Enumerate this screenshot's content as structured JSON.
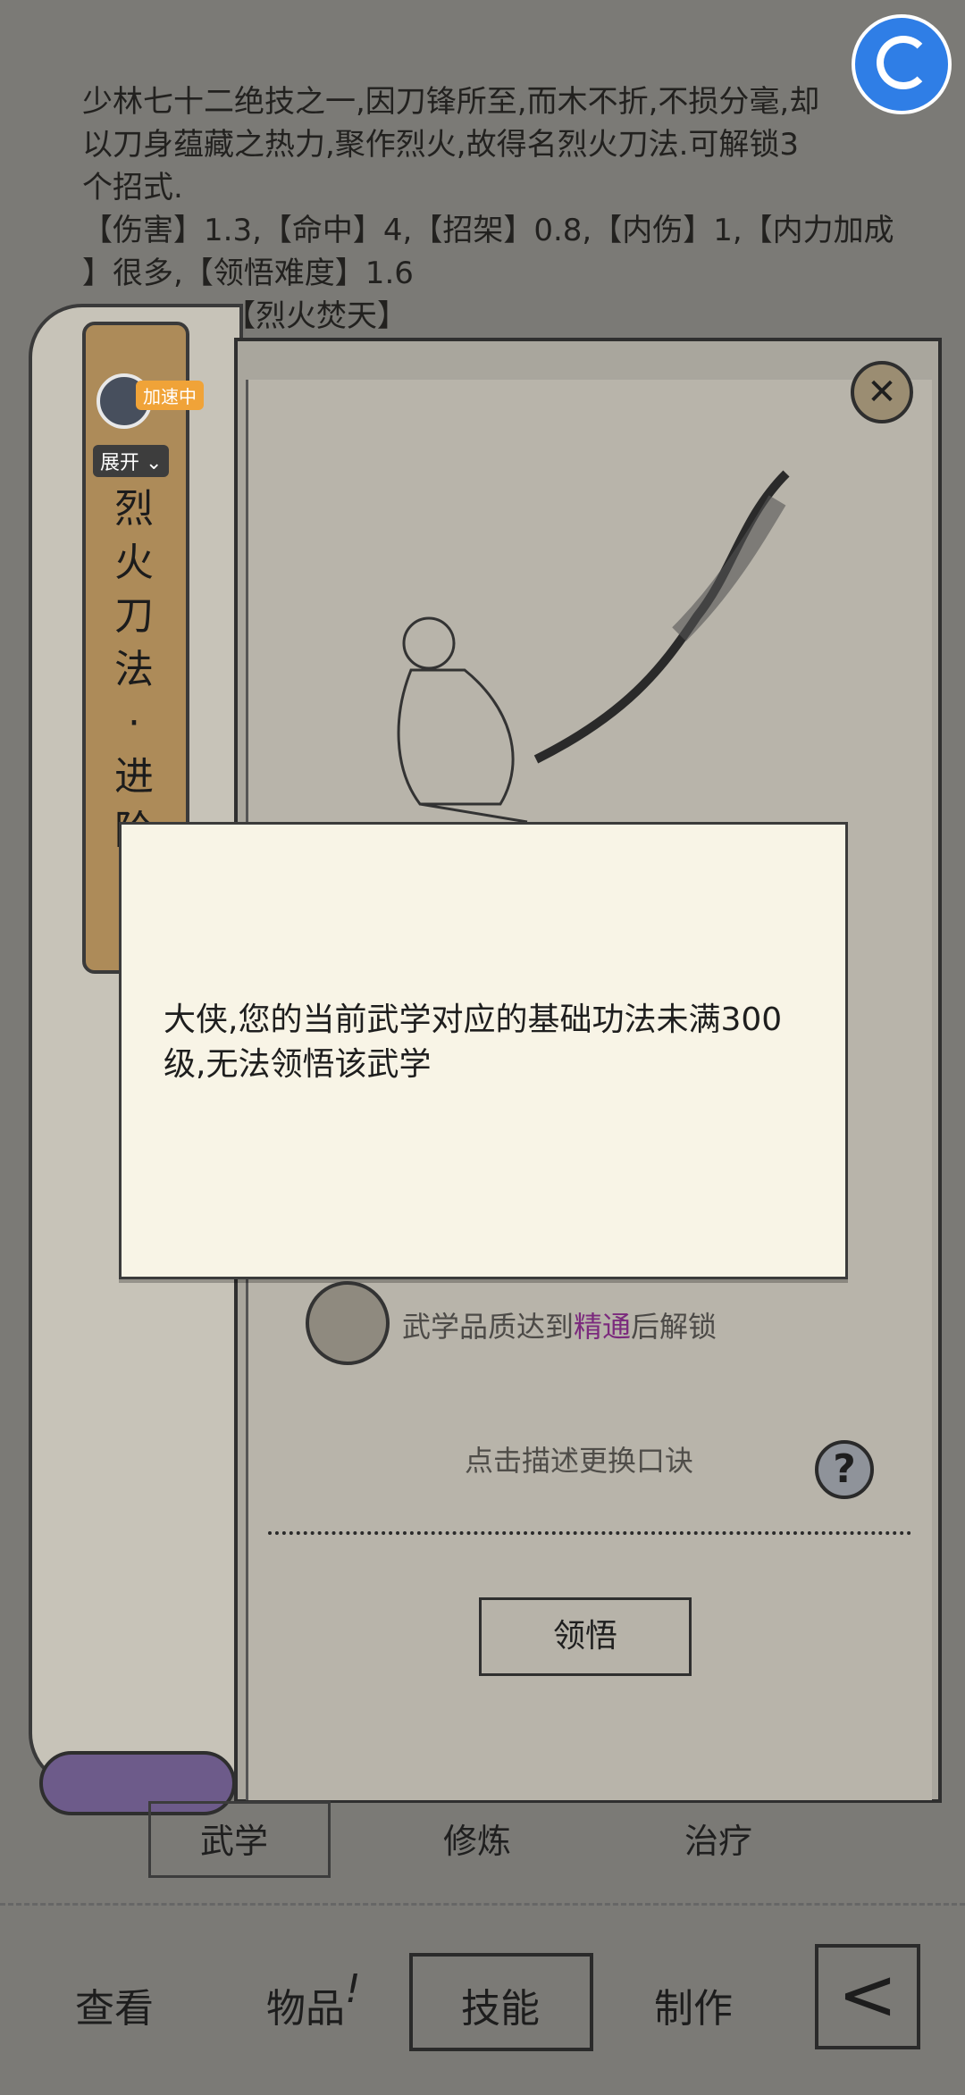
{
  "description": {
    "line1": "少林七十二绝技之一,因刀锋所至,而木不折,不损分毫,却",
    "line2": "以刀身蕴藏之热力,聚作烈火,故得名烈火刀法.可解锁3",
    "line3": "个招式.",
    "line4": "【伤害】1.3,【命中】4,【招架】0.8,【内伤】1,【内力加成",
    "line5": "】很多,【领悟难度】1.6",
    "line6": "【烈火焚天】"
  },
  "speed_widget": {
    "tag": "加速中",
    "expand": "展开"
  },
  "scroll": {
    "title_chars": [
      "烈",
      "火",
      "刀",
      "法",
      "·",
      "进",
      "阶"
    ]
  },
  "panel": {
    "close_icon": "close-icon"
  },
  "modal": {
    "message_line1": "大侠,您的当前武学对应的基础功法未满300",
    "message_line2": "级,无法领悟该武学"
  },
  "unlock": {
    "prefix": "武学品质达到",
    "highlight": "精通",
    "suffix": "后解锁"
  },
  "hint": "点击描述更换口诀",
  "help_symbol": "?",
  "learn_button": "领悟",
  "lower_tabs": [
    "武学",
    "修炼",
    "治疗"
  ],
  "nav": {
    "items": [
      "查看",
      "物品",
      "技能",
      "制作"
    ],
    "item2_mark": "!",
    "back_symbol": "<"
  },
  "colors": {
    "highlight": "#7b2a7d",
    "accent_tag": "#f0a338",
    "ribbon": "#ad8b59"
  }
}
